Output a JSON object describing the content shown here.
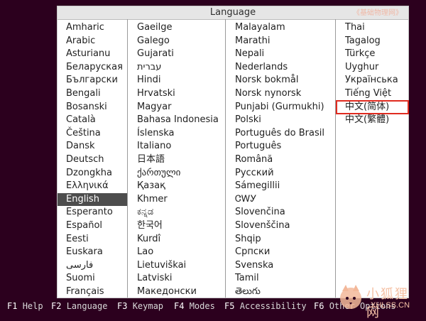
{
  "dialog": {
    "title": "Language",
    "watermark_top": "《基础物理网》"
  },
  "columns": [
    [
      "Amharic",
      "Arabic",
      "Asturianu",
      "Беларуская",
      "Български",
      "Bengali",
      "Bosanski",
      "Català",
      "Čeština",
      "Dansk",
      "Deutsch",
      "Dzongkha",
      "Ελληνικά",
      "English",
      "Esperanto",
      "Español",
      "Eesti",
      "Euskara",
      "فارسی",
      "Suomi",
      "Français"
    ],
    [
      "Gaeilge",
      "Galego",
      "Gujarati",
      "עברית",
      "Hindi",
      "Hrvatski",
      "Magyar",
      "Bahasa Indonesia",
      "Íslenska",
      "Italiano",
      "日本語",
      "ქართული",
      "Қазақ",
      "Khmer",
      "ಕನ್ನಡ",
      "한국어",
      "Kurdî",
      "Lao",
      "Lietuviškai",
      "Latviski",
      "Македонски"
    ],
    [
      "Malayalam",
      "Marathi",
      "Nepali",
      "Nederlands",
      "Norsk bokmål",
      "Norsk nynorsk",
      "Punjabi (Gurmukhi)",
      "Polski",
      "Português do Brasil",
      "Português",
      "Română",
      "Русский",
      "Sámegillii",
      "ᏣᎳᎩ",
      "Slovenčina",
      "Slovenščina",
      "Shqip",
      "Српски",
      "Svenska",
      "Tamil",
      "తెలుగు"
    ],
    [
      "Thai",
      "Tagalog",
      "Türkçe",
      "Uyghur",
      "Українська",
      "Tiếng Việt",
      "中文(简体)",
      "中文(繁體)"
    ]
  ],
  "selected": "English",
  "highlighted": "中文(简体)",
  "footer": [
    {
      "key": "F1",
      "label": "Help"
    },
    {
      "key": "F2",
      "label": "Language"
    },
    {
      "key": "F3",
      "label": "Keymap"
    },
    {
      "key": "F4",
      "label": "Modes"
    },
    {
      "key": "F5",
      "label": "Accessibility"
    },
    {
      "key": "F6",
      "label": "Other Options"
    }
  ],
  "watermark": {
    "text": "小狐狸网",
    "sub": "XHLSS.CN"
  },
  "colors": {
    "background": "#2c001e",
    "selected_bg": "#4d4d4d",
    "highlight_border": "#e02b20"
  }
}
